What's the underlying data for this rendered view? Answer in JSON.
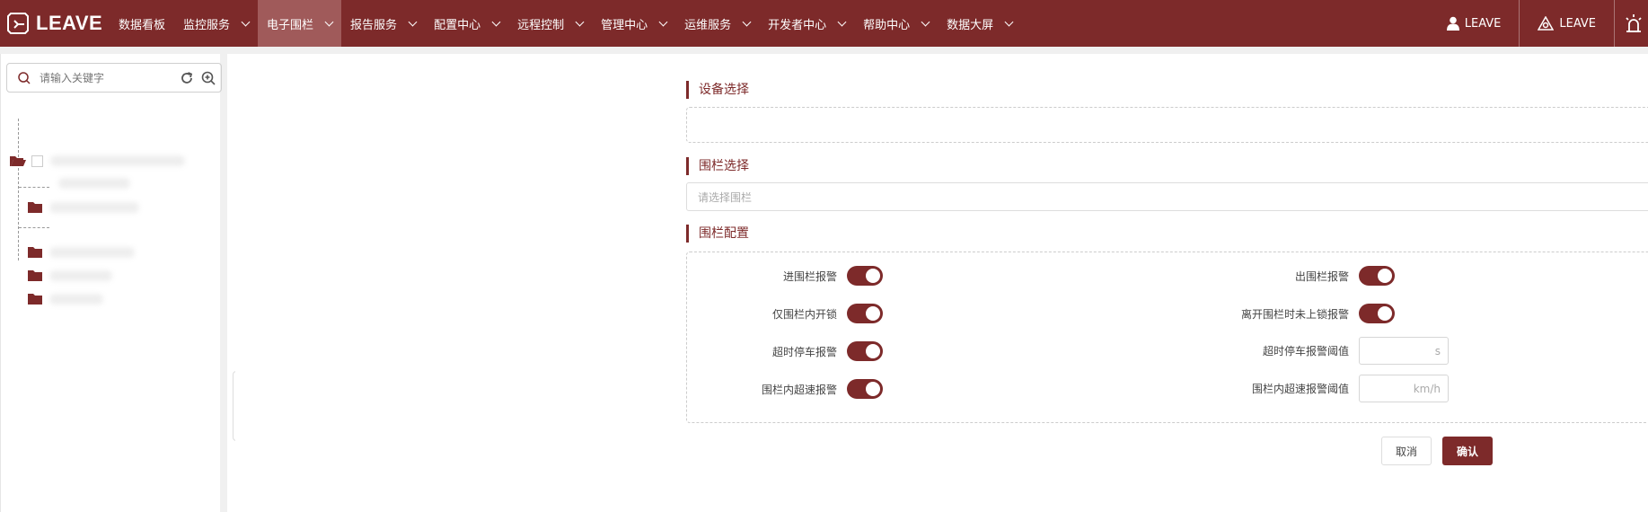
{
  "app": {
    "logo_text": "LEAVE"
  },
  "nav": {
    "items": [
      {
        "label": "数据看板",
        "dropdown": false,
        "active": false
      },
      {
        "label": "监控服务",
        "dropdown": true,
        "active": false
      },
      {
        "label": "电子围栏",
        "dropdown": true,
        "active": true
      },
      {
        "label": "报告服务",
        "dropdown": true,
        "active": false
      },
      {
        "label": "配置中心",
        "dropdown": true,
        "active": false
      },
      {
        "label": "远程控制",
        "dropdown": true,
        "active": false
      },
      {
        "label": "管理中心",
        "dropdown": true,
        "active": false
      },
      {
        "label": "运维服务",
        "dropdown": true,
        "active": false
      },
      {
        "label": "开发者中心",
        "dropdown": true,
        "active": false
      },
      {
        "label": "帮助中心",
        "dropdown": true,
        "active": false
      },
      {
        "label": "数据大屏",
        "dropdown": true,
        "active": false
      }
    ],
    "user_label": "LEAVE",
    "org_label": "LEAVE"
  },
  "sidebar": {
    "search_placeholder": "请输入关键字"
  },
  "sections": {
    "device_title": "设备选择",
    "fence_title": "围栏选择",
    "fence_placeholder": "请选择围栏",
    "config_title": "围栏配置"
  },
  "config": {
    "left": [
      {
        "label": "进围栏报警",
        "enabled": true
      },
      {
        "label": "仅围栏内开锁",
        "enabled": true
      },
      {
        "label": "超时停车报警",
        "enabled": true
      },
      {
        "label": "围栏内超速报警",
        "enabled": true
      }
    ],
    "right_toggles": [
      {
        "label": "出围栏报警",
        "enabled": true
      },
      {
        "label": "离开围栏时未上锁报警",
        "enabled": true
      }
    ],
    "right_inputs": [
      {
        "label": "超时停车报警阈值",
        "unit": "s"
      },
      {
        "label": "围栏内超速报警阈值",
        "unit": "km/h"
      }
    ]
  },
  "buttons": {
    "cancel": "取消",
    "confirm": "确认"
  },
  "colors": {
    "brand": "#7d2a2a",
    "nav_active": "#a05a5a"
  }
}
